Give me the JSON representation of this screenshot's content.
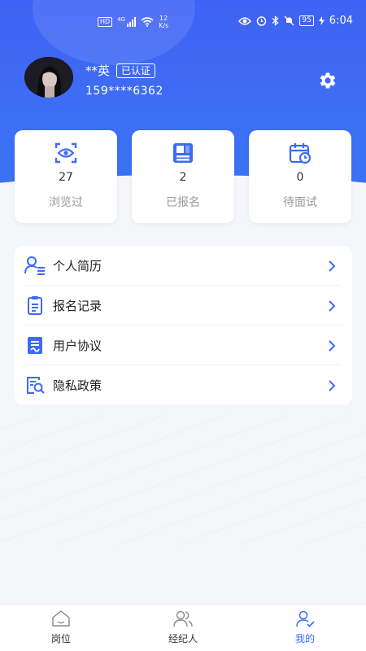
{
  "status_bar": {
    "hd": "HD",
    "network": "4G",
    "net_speed_value": "12",
    "net_speed_unit": "K/s",
    "battery": "95",
    "time": "6:04"
  },
  "profile": {
    "name": "**英",
    "badge": "已认证",
    "phone": "159****6362"
  },
  "stats": [
    {
      "value": "27",
      "label": "浏览过",
      "icon": "eye-scan-icon"
    },
    {
      "value": "2",
      "label": "已报名",
      "icon": "registration-icon"
    },
    {
      "value": "0",
      "label": "待面试",
      "icon": "calendar-clock-icon"
    }
  ],
  "menu": [
    {
      "label": "个人简历",
      "icon": "resume-user-icon"
    },
    {
      "label": "报名记录",
      "icon": "clipboard-icon"
    },
    {
      "label": "用户协议",
      "icon": "agreement-icon"
    },
    {
      "label": "隐私政策",
      "icon": "privacy-search-icon"
    }
  ],
  "tabbar": [
    {
      "label": "岗位",
      "icon": "home-icon",
      "active": false
    },
    {
      "label": "经纪人",
      "icon": "people-icon",
      "active": false
    },
    {
      "label": "我的",
      "icon": "profile-icon",
      "active": true
    }
  ],
  "colors": {
    "brand": "#3e6af6",
    "header": "#3f62f4",
    "background": "#f4f6fa"
  }
}
